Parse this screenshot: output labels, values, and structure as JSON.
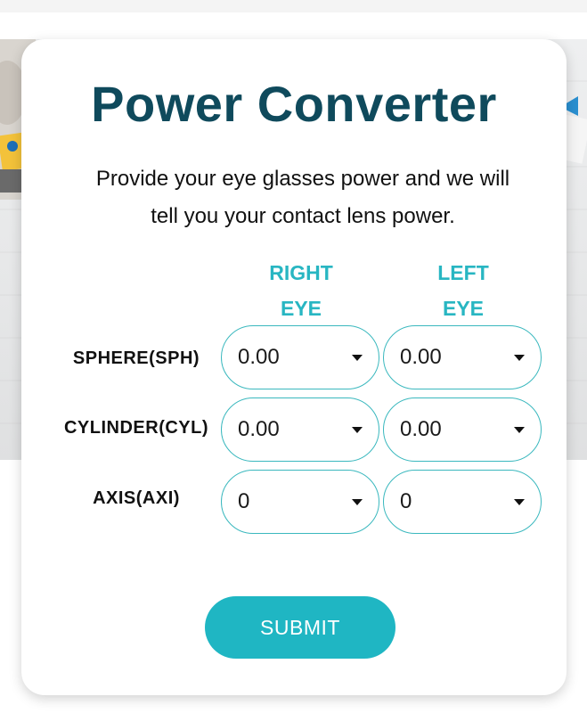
{
  "header": {
    "title": "Power Converter",
    "subtitle_line1": "Provide your eye glasses power and we will",
    "subtitle_line2": "tell you your contact lens power."
  },
  "columns": {
    "right_eye": [
      "RIGHT",
      "EYE"
    ],
    "left_eye": [
      "LEFT",
      "EYE"
    ]
  },
  "rows": [
    {
      "label": "SPHERE(SPH)",
      "right_value": "0.00",
      "left_value": "0.00"
    },
    {
      "label": "CYLINDER(CYL)",
      "right_value": "0.00",
      "left_value": "0.00"
    },
    {
      "label": "AXIS(AXI)",
      "right_value": "0",
      "left_value": "0"
    }
  ],
  "submit_label": "SUBMIT",
  "colors": {
    "title": "#0f4a5c",
    "accent": "#28b6c2",
    "button": "#1fb6c3",
    "select_border": "#3ab8be"
  },
  "icons": {
    "dropdown": "caret-down-icon"
  }
}
